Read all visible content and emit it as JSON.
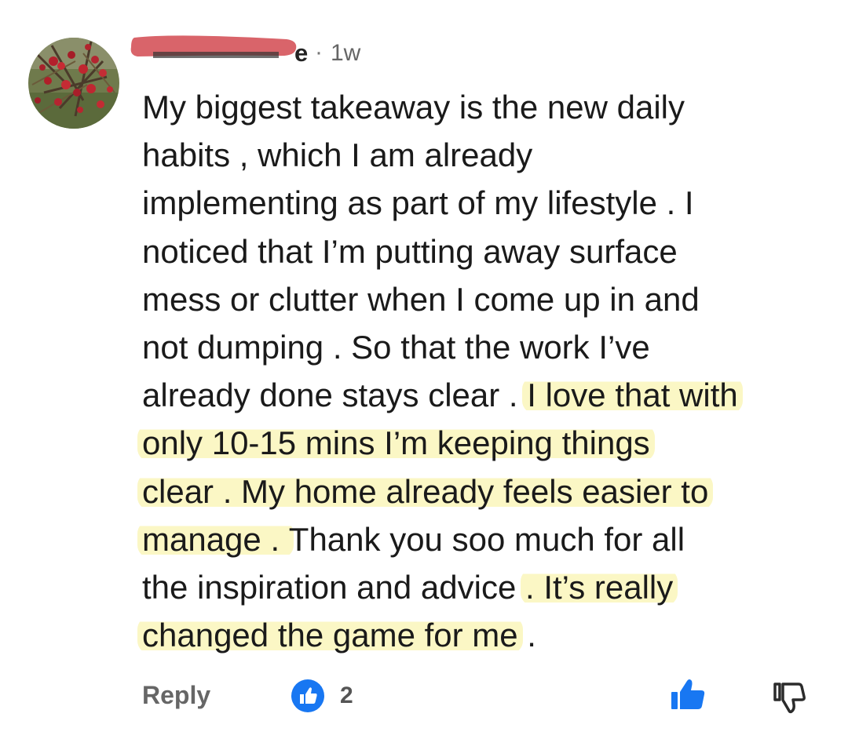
{
  "comment": {
    "author_suffix": "e",
    "separator": "·",
    "time": "1w",
    "lines": [
      [
        "My biggest takeaway is the new daily"
      ],
      [
        "habits , which I am already"
      ],
      [
        "implementing as part of my lifestyle . I"
      ],
      [
        "noticed that I’m putting away surface"
      ],
      [
        "mess or clutter when I come up in and"
      ],
      [
        "not dumping . So that the work I’ve"
      ],
      [
        "already done stays clear . ",
        "I love that with"
      ],
      [
        "only 10-15 mins I’m keeping things"
      ],
      [
        "clear . My home already feels easier to"
      ],
      [
        "manage . ",
        "Thank you soo much for all"
      ],
      [
        "the inspiration and advice ",
        ". It’s really"
      ],
      [
        "changed the game for me",
        " ."
      ]
    ],
    "highlighted": [
      [
        false
      ],
      [
        false
      ],
      [
        false
      ],
      [
        false
      ],
      [
        false
      ],
      [
        false
      ],
      [
        false,
        true
      ],
      [
        true
      ],
      [
        true
      ],
      [
        true,
        false
      ],
      [
        false,
        true
      ],
      [
        true,
        false
      ]
    ]
  },
  "footer": {
    "reply_label": "Reply",
    "like_count": "2",
    "like_icon": "thumbs-up-icon",
    "dislike_icon": "thumbs-down-icon"
  },
  "colors": {
    "highlight": "#fbf7c5",
    "like_blue": "#1877f2",
    "redaction": "#d9646a"
  }
}
